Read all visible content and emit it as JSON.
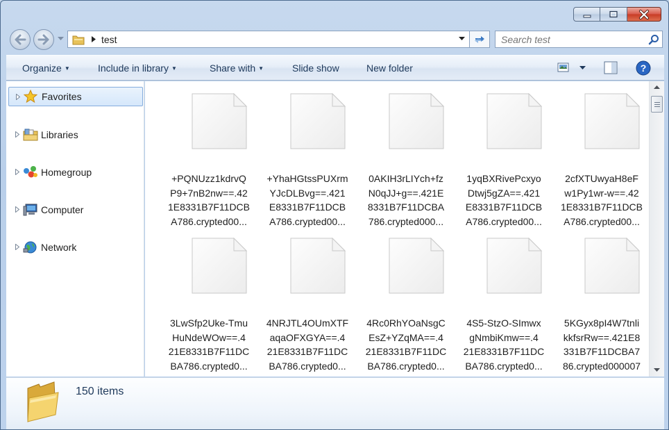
{
  "window": {
    "address": {
      "crumb": "test"
    },
    "search": {
      "placeholder": "Search test"
    }
  },
  "toolbar": {
    "organize": "Organize",
    "include": "Include in library",
    "share": "Share with",
    "slideshow": "Slide show",
    "newfolder": "New folder"
  },
  "sidebar": {
    "items": [
      {
        "label": "Favorites",
        "icon": "star-icon"
      },
      {
        "label": "Libraries",
        "icon": "libraries-icon"
      },
      {
        "label": "Homegroup",
        "icon": "homegroup-icon"
      },
      {
        "label": "Computer",
        "icon": "computer-icon"
      },
      {
        "label": "Network",
        "icon": "network-icon"
      }
    ]
  },
  "files": [
    {
      "l1": "+PQNUzz1kdrvQ",
      "l2": "P9+7nB2nw==.42",
      "l3": "1E8331B7F11DCB",
      "l4": "A786.crypted00..."
    },
    {
      "l1": "+YhaHGtssPUXrm",
      "l2": "YJcDLBvg==.421",
      "l3": "E8331B7F11DCB",
      "l4": "A786.crypted00..."
    },
    {
      "l1": "0AKIH3rLIYch+fz",
      "l2": "N0qJJ+g==.421E",
      "l3": "8331B7F11DCBA",
      "l4": "786.crypted000..."
    },
    {
      "l1": "1yqBXRivePcxyo",
      "l2": "Dtwj5gZA==.421",
      "l3": "E8331B7F11DCB",
      "l4": "A786.crypted00..."
    },
    {
      "l1": "2cfXTUwyaH8eF",
      "l2": "w1Py1wr-w==.42",
      "l3": "1E8331B7F11DCB",
      "l4": "A786.crypted00..."
    },
    {
      "l1": "3LwSfp2Uke-Tmu",
      "l2": "HuNdeWOw==.4",
      "l3": "21E8331B7F11DC",
      "l4": "BA786.crypted0..."
    },
    {
      "l1": "4NRJTL4OUmXTF",
      "l2": "aqaOFXGYA==.4",
      "l3": "21E8331B7F11DC",
      "l4": "BA786.crypted0..."
    },
    {
      "l1": "4Rc0RhYOaNsgC",
      "l2": "EsZ+YZqMA==.4",
      "l3": "21E8331B7F11DC",
      "l4": "BA786.crypted0..."
    },
    {
      "l1": "4S5-StzO-SImwx",
      "l2": "gNmbiKmw==.4",
      "l3": "21E8331B7F11DC",
      "l4": "BA786.crypted0..."
    },
    {
      "l1": "5KGyx8pI4W7tnli",
      "l2": "kkfsrRw==.421E8",
      "l3": "331B7F11DCBA7",
      "l4": "86.crypted000007"
    }
  ],
  "status": {
    "count": "150 items"
  }
}
